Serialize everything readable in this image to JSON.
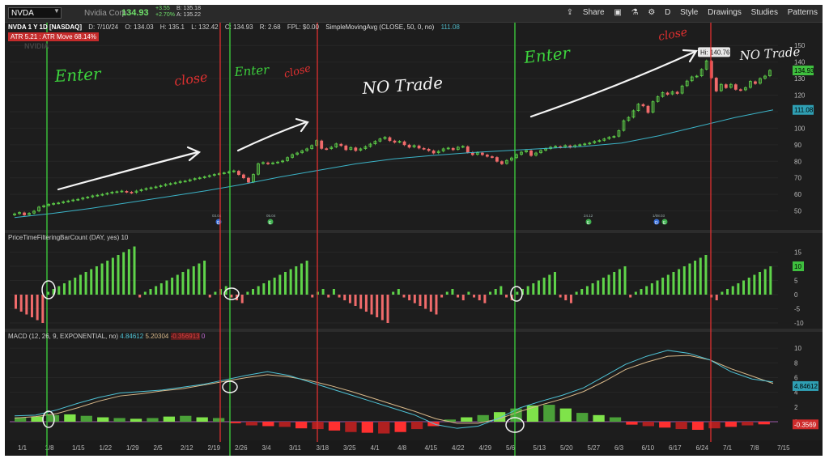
{
  "toolbar": {
    "symbol": "NVDA",
    "company": "Nvidia Corp",
    "last": "134.93",
    "change": "+3.55",
    "change_pct": "+2.70%",
    "bid": "B: 135.18",
    "ask": "A: 135.22",
    "buttons": [
      "Share",
      "D",
      "Style",
      "Drawings",
      "Studies",
      "Patterns"
    ]
  },
  "header": {
    "title": "NVDA 1 Y 1D [NASDAQ]",
    "date": "D: 7/10/24",
    "open": "O: 134.03",
    "high": "H: 135.1",
    "low": "L: 132.42",
    "close": "C: 134.93",
    "range": "R: 2.68",
    "fpl": "FPL: $0.00",
    "sma_label": "SimpleMovingAvg (CLOSE, 50, 0, no)",
    "sma_value": "111.08",
    "atr": "ATR 5.21 : ATR Move 68.14%",
    "watermark": "NVIDIA"
  },
  "colors": {
    "background": "#1d1d1d",
    "up": "#5fd44a",
    "down": "#f06b6b",
    "sma": "#3bb3c7",
    "macd": "#4fc3d6",
    "signal": "#d9b98a",
    "green_line": "#3dd43d",
    "red_line": "#e03030"
  },
  "chart_data": [
    {
      "type": "candlestick",
      "ylim": [
        40,
        155
      ],
      "y_ticks": [
        "150",
        "140",
        "130",
        "120",
        "110",
        "100",
        "90",
        "80",
        "70",
        "60",
        "50"
      ],
      "x_ticks": [
        "1/1",
        "1/8",
        "1/15",
        "1/22",
        "1/29",
        "2/5",
        "2/12",
        "2/19",
        "2/26",
        "3/4",
        "3/11",
        "3/18",
        "3/25",
        "4/1",
        "4/8",
        "4/15",
        "4/22",
        "4/29",
        "5/6",
        "5/13",
        "5/20",
        "5/27",
        "6/3",
        "6/10",
        "6/17",
        "6/24",
        "7/1",
        "7/8",
        "7/15"
      ],
      "close_series": [
        48.2,
        49.0,
        47.6,
        48.5,
        49.8,
        52.3,
        53.1,
        53.9,
        54.5,
        54.8,
        55.5,
        56.0,
        56.6,
        57.0,
        57.8,
        58.3,
        59.1,
        59.5,
        60.0,
        60.6,
        61.3,
        61.6,
        62.0,
        61.5,
        61.0,
        62.0,
        62.8,
        63.5,
        64.0,
        64.5,
        65.2,
        66.0,
        66.5,
        67.0,
        67.8,
        68.0,
        68.8,
        69.5,
        70.0,
        70.6,
        71.3,
        72.0,
        72.5,
        73.0,
        73.6,
        74.2,
        72.0,
        70.0,
        67.4,
        72.0,
        78.5,
        79.2,
        78.5,
        79.0,
        79.5,
        80.2,
        82.2,
        84.0,
        85.0,
        86.3,
        87.5,
        89.5,
        92.5,
        87.8,
        87.5,
        88.5,
        90.5,
        89.5,
        87.0,
        88.3,
        86.5,
        87.5,
        88.8,
        90.4,
        92.0,
        93.5,
        94.5,
        92.5,
        91.5,
        92.0,
        90.0,
        88.5,
        89.5,
        88.0,
        87.5,
        86.5,
        85.0,
        86.0,
        87.5,
        88.0,
        87.0,
        88.5,
        89.0,
        85.5,
        84.0,
        85.2,
        84.0,
        83.0,
        82.5,
        80.0,
        78.5,
        80.5,
        82.0,
        84.0,
        85.5,
        86.5,
        83.5,
        85.0,
        86.5,
        87.5,
        88.5,
        89.0,
        88.5,
        89.5,
        88.5,
        89.5,
        90.0,
        90.5,
        91.0,
        92.0,
        92.5,
        93.5,
        94.5,
        95.0,
        98.5,
        104.5,
        106.5,
        110.5,
        114.5,
        113.5,
        109.5,
        116.0,
        119.0,
        121.5,
        120.5,
        122.0,
        121.0,
        125.5,
        128.5,
        131.0,
        131.5,
        135.5,
        140.7,
        130.5,
        122.5,
        126.5,
        124.5,
        126.5,
        123.5,
        123.0,
        124.5,
        128.3,
        127.0,
        130.0,
        131.5,
        134.93
      ],
      "sma_series": [
        46.0,
        48.5,
        51.5,
        55.0,
        58.5,
        62.0,
        66.0,
        70.5,
        74.5,
        78.5,
        81.5,
        83.5,
        85.2,
        86.5,
        87.8,
        89.0,
        91.0,
        95.5,
        101.0,
        106.5,
        111.08
      ],
      "hi_label": "Hi: 140.76",
      "price_badge": "134.93",
      "sma_badge": "111.08",
      "event_markers": [
        "D",
        "E",
        "E",
        "D",
        "E"
      ],
      "event_labels": [
        "03.04",
        "05.04",
        "24.12",
        "1/08.03"
      ]
    },
    {
      "type": "bar",
      "title": "PriceTimeFilteringBarCount (DAY, yes)",
      "title_value": "10",
      "ylim": [
        -12,
        18
      ],
      "y_ticks": [
        "15",
        "10",
        "5",
        "0",
        "-5",
        "-10"
      ],
      "last_badge": "10",
      "values": [
        -5,
        -6,
        -7,
        -8,
        -9,
        -10,
        1,
        2,
        3,
        4,
        5,
        6,
        7,
        8,
        9,
        10,
        11,
        12,
        13,
        14,
        15,
        16,
        17,
        -1,
        1,
        2,
        3,
        4,
        5,
        6,
        7,
        8,
        9,
        10,
        11,
        12,
        -1,
        1,
        2,
        3,
        -1,
        -2,
        -3,
        1,
        2,
        3,
        4,
        5,
        6,
        7,
        8,
        9,
        10,
        11,
        12,
        -1,
        1,
        2,
        -1,
        2,
        -1,
        -2,
        -3,
        -4,
        -5,
        -6,
        -7,
        -8,
        -9,
        -10,
        1,
        2,
        -1,
        -2,
        -3,
        -4,
        -5,
        -6,
        -7,
        -1,
        1,
        2,
        -1,
        -2,
        1,
        -1,
        -2,
        -3,
        1,
        2,
        3,
        -1,
        -2,
        1,
        2,
        3,
        4,
        5,
        6,
        7,
        8,
        -1,
        -2,
        -3,
        1,
        2,
        3,
        4,
        5,
        6,
        7,
        8,
        9,
        10,
        -1,
        1,
        2,
        3,
        4,
        5,
        6,
        7,
        8,
        9,
        10,
        11,
        12,
        13,
        14,
        -1,
        -2,
        1,
        2,
        3,
        4,
        5,
        6,
        7,
        8,
        9,
        10
      ]
    },
    {
      "type": "line",
      "title": "MACD (12, 26, 9, EXPONENTIAL, no)",
      "values_text": [
        "4.84612",
        "5.20304",
        "-0.356913",
        "0"
      ],
      "ylim": [
        -2.2,
        11
      ],
      "y_ticks": [
        "10",
        "8",
        "6",
        "4",
        "2",
        "0"
      ],
      "macd_badge": "4.84612",
      "hist_badge": "-0.3569",
      "macd_series": [
        0.8,
        0.9,
        1.6,
        2.5,
        3.3,
        3.9,
        4.1,
        4.3,
        4.7,
        5.1,
        5.7,
        6.3,
        6.8,
        6.3,
        5.4,
        4.5,
        3.6,
        2.7,
        1.8,
        0.9,
        -0.4,
        -0.9,
        -0.6,
        0.5,
        1.9,
        2.8,
        3.6,
        4.6,
        6.2,
        7.8,
        8.9,
        9.7,
        9.3,
        8.4,
        6.8,
        5.8,
        5.4
      ],
      "signal_series": [
        0.5,
        0.7,
        1.1,
        1.9,
        2.8,
        3.5,
        3.8,
        4.2,
        4.5,
        5.0,
        5.5,
        6.0,
        6.4,
        6.1,
        5.6,
        4.9,
        4.1,
        3.2,
        2.3,
        1.4,
        0.4,
        -0.2,
        -0.2,
        0.4,
        1.4,
        2.3,
        3.1,
        4.1,
        5.5,
        7.1,
        8.1,
        8.9,
        9.0,
        8.4,
        7.2,
        6.2,
        5.2
      ],
      "histogram": [
        0.6,
        0.7,
        0.9,
        1.0,
        0.8,
        0.6,
        0.5,
        0.4,
        0.5,
        0.7,
        0.8,
        0.6,
        0.5,
        -0.2,
        -0.5,
        -0.6,
        -0.7,
        -0.9,
        -1.0,
        -1.2,
        -1.4,
        -1.5,
        -1.6,
        -1.4,
        -1.0,
        -0.6,
        0.3,
        0.6,
        0.9,
        1.3,
        1.8,
        2.2,
        2.3,
        1.8,
        1.2,
        0.9,
        0.6,
        -0.4,
        -0.6,
        -0.8,
        -1.0,
        -1.1,
        -0.9,
        -0.7,
        -0.5,
        -0.36
      ]
    }
  ],
  "annotations": {
    "texts": [
      "Enter",
      "close",
      "Enter",
      "close",
      "NO Trade",
      "Enter",
      "close",
      "NO Trade"
    ],
    "green_lines_at": [
      "1/8",
      "2/21",
      "5/3"
    ],
    "red_lines_at": [
      "2/20",
      "3/14",
      "6/20"
    ]
  }
}
